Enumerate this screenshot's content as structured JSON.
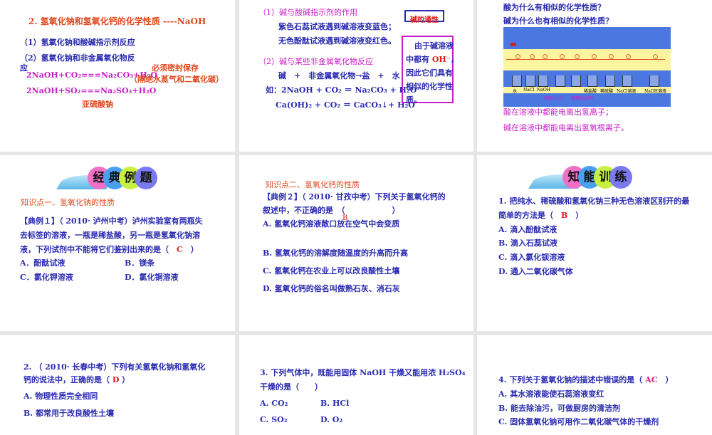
{
  "slides": [
    {
      "title": "2. 氢氧化钠和氢氧化钙的化学性质 ----NaOH",
      "l1": "（1）氢氧化钠和酸碱指示剂反应",
      "l2": "（2）氢氧化钠和非金属氧化物反",
      "l2b": "应",
      "eq1": "2NaOH+CO₂===Na₂CO₃+H₂O",
      "eq2": "2NaOH+SO₂===Na₂SO₃+H₂O",
      "note1": "必须密封保存",
      "note2": "（隔绝水蒸气和二氧化碳）",
      "sulfite": "亚硫酸钠"
    },
    {
      "h1": "（1）碱与酸碱指示剂的作用",
      "a1": "紫色石蕊试液遇到碱溶液变蓝色；",
      "a2": "无色酚酞试液遇到碱溶液变红色。",
      "h2": "（2）碱与某些非金属氧化物反应",
      "b1": "碱　+　非金属氧化物→盐　+　水",
      "b2": "如：2NaOH + CO₂ ＝ Na₂CO₃ + H₂O",
      "b3": "Ca(OH)₂ + CO₂ ＝ CaCO₃↓+ H₂O",
      "tag": "碱的通性",
      "side1": "由于碱溶液",
      "side2a": "中都有 ",
      "side2b": "OH⁻",
      "side2c": "，",
      "side3": "因此它们具有",
      "side4": "相似的化学性",
      "side5": "质。"
    },
    {
      "q1": "酸为什么有相似的化学性质？",
      "q2": "碱为什么也有相似的化学性质？",
      "labels": [
        "水",
        "NaCl",
        "NaOH",
        "稀盐酸",
        "稀硫酸",
        "NaCl溶液",
        "NaOH溶液"
      ],
      "melt": [
        "熔融NaCl",
        "熔融NaOH"
      ],
      "c1": "酸在溶液中都能电离出氢离子；",
      "c2": "碱在溶液中都能电离出氢氧根离子。"
    },
    {
      "banner": [
        "经",
        "典",
        "例",
        "题"
      ],
      "kp": "知识点一、氢氧化钠的性质",
      "p1": "【典例１】（ 2010· 泸州中考）泸州实验室有两瓶失",
      "p2": "去标签的溶液，一瓶是稀盐酸，另一瓶是氢氧化钠溶",
      "p3": "液，下列试剂中不能将它们鉴别出来的是（　",
      "ans": "C",
      "p3e": "　）",
      "A": "A．酚酞试液",
      "B": "B．镁条",
      "C": "C．氯化钾溶液",
      "D": "D．氯化铜溶液"
    },
    {
      "kp": "知识点二、氢氧化钙的性质",
      "p1": "【典例２】（ 2010· 甘孜中考）下列关于氢氧化钙的",
      "p2": "叙述中，不正确的是　（　　　　　　）",
      "ans": "B",
      "A": "A. 氢氧化钙溶液敞口放在空气中会变质",
      "B": "B. 氢氧化钙的溶解度随温度的升高而升高",
      "C": "C. 氢氧化钙在农业上可以改良酸性土壤",
      "D": "D. 氢氧化钙的俗名叫做熟石灰、消石灰"
    },
    {
      "banner": [
        "知",
        "能",
        "训",
        "练"
      ],
      "p1": "1. 把纯水、稀硫酸和氢氧化钠三种无色溶液区别开的最",
      "p2": "简单的方法是（　",
      "ans": "B",
      "p2e": "　）",
      "A": "A. 滴入酚酞试液",
      "B": "B. 滴入石蕊试液",
      "C": "C. 滴入氯化钡溶液",
      "D": "D. 通入二氧化碳气体"
    },
    {
      "p1": "2. （ 2010· 长春中考）下列有关氢氧化钠和氢氧化",
      "p2": "钙的说法中，正确的是（ ",
      "ans": "D",
      "p2e": " ）",
      "A": "A. 物理性质完全相同",
      "B": "B. 都常用于改良酸性土壤"
    },
    {
      "p1": "3. 下列气体中，既能用固体 NaOH 干燥又能用浓 H₂SO₄",
      "p2": "干燥的是（　　）",
      "A": "A. CO₂",
      "B": "B. HCl",
      "C": "C. SO₂",
      "D": "D. O₂"
    },
    {
      "p1": "4. 下列关于氢氧化钠的描述中错误的是（ ",
      "ans": "AC",
      "p1e": "　）",
      "A": "A. 其水溶液能使石蕊溶液变红",
      "B": "B. 能去除油污，可做厨房的清洁剂",
      "C": "C. 固体氢氧化钠可用作二氧化碳气体的干燥剂"
    }
  ]
}
